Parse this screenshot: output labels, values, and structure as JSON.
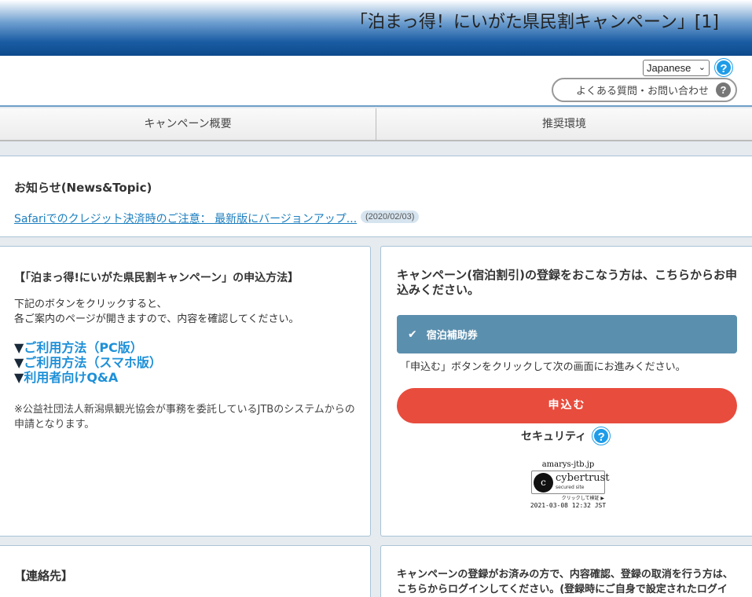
{
  "header": {
    "title": "「泊まっ得！にいがた県民割キャンペーン」[1]"
  },
  "topbar": {
    "language": "Japanese",
    "help_label": "?",
    "faq_label": "よくある質問・お問い合わせ",
    "faq_icon": "?"
  },
  "tabs": [
    {
      "label": "キャンペーン概要"
    },
    {
      "label": "推奨環境"
    }
  ],
  "news": {
    "title": "お知らせ(News&Topic)",
    "items": [
      {
        "text": "Safariでのクレジット決済時のご注意： 最新版にバージョンアップ...",
        "date": "(2020/02/03)"
      }
    ]
  },
  "apply_method": {
    "heading": "【「泊まっ得!にいがた県民割キャンペーン」の申込方法】",
    "desc_line1": "下記のボタンをクリックすると、",
    "desc_line2": "各ご案内のページが開きますので、内容を確認してください。",
    "links": [
      {
        "marker": "▼",
        "label": "ご利用方法（PC版）"
      },
      {
        "marker": "▼",
        "label": "ご利用方法（スマホ版）"
      },
      {
        "marker": "▼",
        "label": "利用者向けQ&A"
      }
    ],
    "note": "※公益社団法人新潟県観光協会が事務を委託しているJTBのシステムからの申請となります。"
  },
  "registration": {
    "heading": "キャンペーン(宿泊割引)の登録をおこなう方は、こちらからお申込みください。",
    "option_label": "宿泊補助券",
    "hint": "「申込む」ボタンをクリックして次の画面にお進みください。",
    "apply_button": "申込む",
    "security_label": "セキュリティ",
    "seal": {
      "domain": "amarys-jtb.jp",
      "brand": "cybertrust",
      "sub": "secured site",
      "click": "クリックして検証 ▶",
      "time": "2021-03-08 12:32 JST"
    }
  },
  "contact": {
    "title": "【連絡先】"
  },
  "login": {
    "text": "キャンペーンの登録がお済みの方で、内容確認、登録の取消を行う方は、こちらからログインしてください。(登録時にご自身で設定されたログイ"
  },
  "colors": {
    "header_blue": "#1a5ca3",
    "accent_blue": "#1e9ce8",
    "apply_red": "#e84c3d",
    "option_blue": "#5b8fae"
  }
}
